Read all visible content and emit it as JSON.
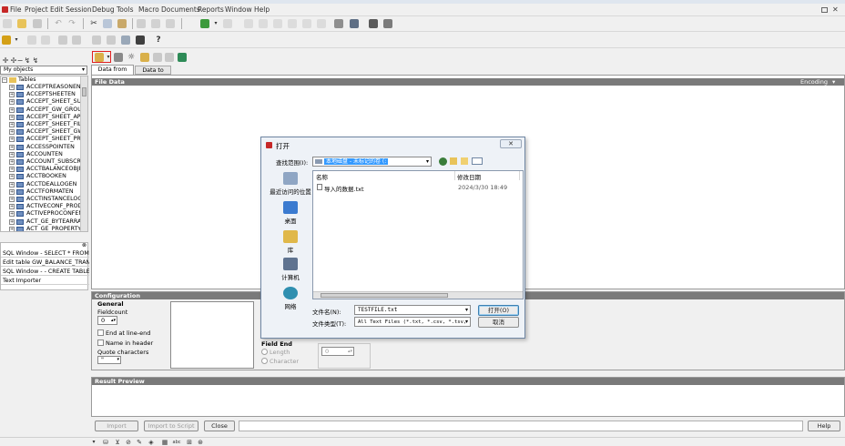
{
  "app": {
    "title": ""
  },
  "menu": [
    "File",
    "Project",
    "Edit",
    "Session",
    "Debug",
    "Tools",
    "Macro",
    "Documents",
    "Reports",
    "Window",
    "Help"
  ],
  "left_panel": {
    "filter_value": "My objects",
    "tree_root": "Tables",
    "tables": [
      "ACCEPTREASONEN",
      "ACCEPTSHEETEN",
      "ACCEPT_SHEET_SUBSI",
      "ACCEPT_GW_GROUP_",
      "ACCEPT_SHEET_APPO",
      "ACCEPT_SHEET_FILE_",
      "ACCEPT_SHEET_GW_",
      "ACCEPT_SHEET_PRO",
      "ACCESSPOINTEN",
      "ACCOUNTEN",
      "ACCOUNT_SUBSCRIBI",
      "ACCTBALANCEOBJEN",
      "ACCTBOOKEN",
      "ACCTDEALLOGEN",
      "ACCTFORMATEN",
      "ACCTINSTANCELOGEN",
      "ACTIVECONF_PRODUK",
      "ACTIVEPROCONFEN",
      "ACT_GE_BYTEARRAY",
      "ACT_GE_PROPERTY"
    ],
    "windows": [
      "SQL Window - SELECT * FROM DBTE",
      "Edit table GW_BALANCE_TRANSFEF",
      "SQL Window - - CREATE TABLE CRI",
      "Text Importer"
    ]
  },
  "importer": {
    "tabs": [
      "Data from Textfile",
      "Data to Oracle"
    ],
    "file_data_label": "File Data",
    "encoding_label": "Encoding",
    "config_label": "Configuration",
    "general_label": "General",
    "fieldcount_label": "Fieldcount",
    "fieldcount_value": "0",
    "end_at_line_end": "End at line-end",
    "name_in_header": "Name in header",
    "quote_characters": "Quote characters",
    "quote_value": "\"",
    "field_end_label": "Field End",
    "length_label": "Length",
    "character_label": "Character",
    "length_value": "0",
    "result_preview_label": "Result Preview",
    "buttons": {
      "import": "Import",
      "import_to_script": "Import to Script",
      "close": "Close",
      "help": "Help"
    }
  },
  "dialog": {
    "title": "打开",
    "look_in_label": "查找范围(I):",
    "look_in_value": "本地磁盘 - 未标记的卷 (:",
    "places": [
      "最近访问的位置",
      "桌面",
      "库",
      "计算机",
      "网络"
    ],
    "columns": {
      "name": "名称",
      "date": "修改日期"
    },
    "files": [
      {
        "name": "导入的数据.txt",
        "date": "2024/3/30 18:49"
      }
    ],
    "filename_label": "文件名(N):",
    "filename_value": "TESTFILE.txt",
    "filetype_label": "文件类型(T):",
    "filetype_value": "All Text Files (*.txt, *.csv, *.tsv,",
    "open_button": "打开(O)",
    "cancel_button": "取消"
  },
  "colors": {
    "highlight_border": "#e02020",
    "selection": "#3399ff",
    "panel_head": "#7a7a7a"
  }
}
